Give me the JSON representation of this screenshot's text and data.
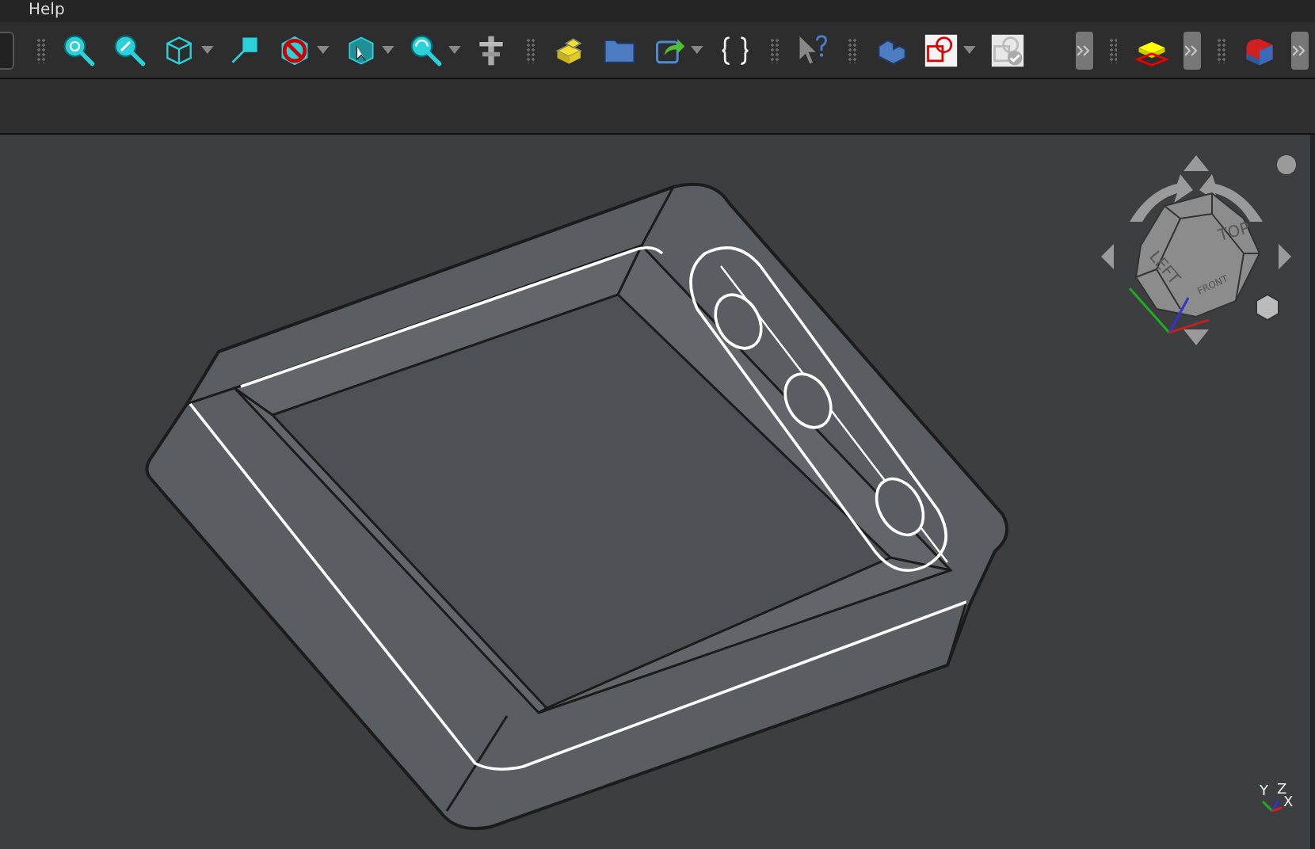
{
  "menu_bar": {
    "items": [
      {
        "label": "Help"
      }
    ]
  },
  "navigation_cube": {
    "faces": [
      "TOP",
      "LEFT",
      "FRONT"
    ]
  },
  "axis_indicator": {
    "labels": [
      "Y",
      "Z",
      "X"
    ]
  }
}
